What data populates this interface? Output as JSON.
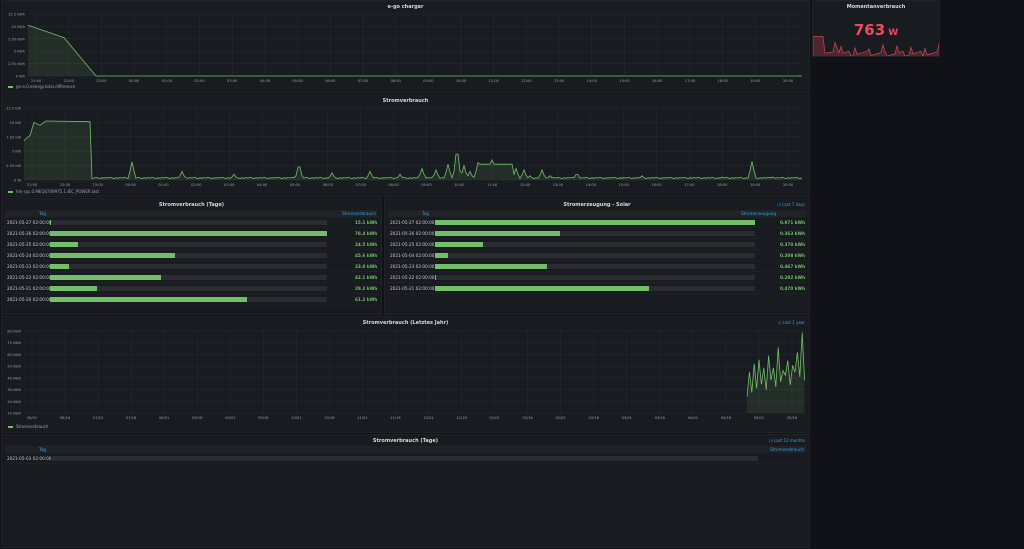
{
  "accent": "#73bf69",
  "link_color": "#33a2e5",
  "stat_color": "#f2495c",
  "x_times": [
    "21:00",
    "22:00",
    "23:00",
    "00:00",
    "01:00",
    "02:00",
    "03:00",
    "04:00",
    "05:00",
    "06:00",
    "07:00",
    "08:00",
    "09:00",
    "10:00",
    "11:00",
    "12:00",
    "13:00",
    "14:00",
    "15:00",
    "16:00",
    "17:00",
    "18:00",
    "19:00",
    "20:00"
  ],
  "charger": {
    "title": "e-go charger",
    "y_ticks": [
      "12.5 kWh",
      "10 kWh",
      "7.50 kWh",
      "5 kWh",
      "2.50 kWh",
      "0 Wh"
    ],
    "legend": "go-e.0.energy.total.difference"
  },
  "verbrauch": {
    "title": "Stromverbrauch",
    "y_ticks": [
      "12.5 kW",
      "10 kW",
      "7.50 kW",
      "5 kW",
      "2.50 kW",
      "0 W"
    ],
    "legend": "hm-rpc.0.MEQ0709975.1.IEC_POWER.last"
  },
  "moment": {
    "title": "Momentanverbrauch",
    "value": "763",
    "unit": "W"
  },
  "tage": {
    "title": "Stromverbrauch (Tage)",
    "col_tag": "Tag",
    "col_val": "Stromverbrauch",
    "rows": [
      {
        "date": "2021-05-27 02:00:00",
        "val": "15.1 kWh",
        "pct": 0.004
      },
      {
        "date": "2021-05-26 02:00:00",
        "val": "78.4 kWh",
        "pct": 1.0
      },
      {
        "date": "2021-05-25 02:00:00",
        "val": "24.5 kWh",
        "pct": 0.1
      },
      {
        "date": "2021-05-24 02:00:00",
        "val": "45.6 kWh",
        "pct": 0.45
      },
      {
        "date": "2021-05-23 02:00:00",
        "val": "23.0 kWh",
        "pct": 0.07
      },
      {
        "date": "2021-05-22 02:00:00",
        "val": "42.1 kWh",
        "pct": 0.4
      },
      {
        "date": "2021-05-21 02:00:00",
        "val": "29.2 kWh",
        "pct": 0.17
      },
      {
        "date": "2021-05-20 02:00:00",
        "val": "61.2 kWh",
        "pct": 0.71
      }
    ]
  },
  "solar": {
    "title": "Stromerzeugung - Solar",
    "time_range": "Last 7 days",
    "col_tag": "Tag",
    "col_val": "Stromerzeugung",
    "rows": [
      {
        "date": "2021-05-27 02:00:00",
        "val": "0.871 kWh",
        "pct": 1.0
      },
      {
        "date": "2021-05-26 02:00:00",
        "val": "0.363 kWh",
        "pct": 0.39
      },
      {
        "date": "2021-05-25 02:00:00",
        "val": "0.370 kWh",
        "pct": 0.15
      },
      {
        "date": "2021-05-04 02:00:00",
        "val": "0.308 kWh",
        "pct": 0.04
      },
      {
        "date": "2021-05-23 02:00:00",
        "val": "0.467 kWh",
        "pct": 0.35
      },
      {
        "date": "2021-05-22 02:00:00",
        "val": "0.282 kWh",
        "pct": 0.003
      },
      {
        "date": "2021-05-21 02:00:00",
        "val": "0.470 kWh",
        "pct": 0.67
      }
    ]
  },
  "jahr": {
    "title": "Stromverbrauch (Letztes Jahr)",
    "time_range": "Last 1 year",
    "y_ticks": [
      "80 kWh",
      "70 kWh",
      "60 kWh",
      "50 kWh",
      "40 kWh",
      "30 kWh",
      "20 kWh",
      "10 kWh"
    ],
    "x_ticks": [
      "06/01",
      "06/16",
      "07/01",
      "07/16",
      "08/01",
      "08/16",
      "09/01",
      "09/16",
      "10/01",
      "10/16",
      "11/01",
      "11/16",
      "12/01",
      "12/16",
      "01/01",
      "01/16",
      "02/01",
      "02/16",
      "03/01",
      "03/16",
      "04/01",
      "04/16",
      "05/01",
      "05/16"
    ],
    "legend": "Stromverbrauch"
  },
  "monat": {
    "title": "Stromverbrauch (Tage)",
    "time_range": "Last 12 months",
    "col_tag": "Tag",
    "col_val": "Stromverbrauch",
    "rows": [
      {
        "date": "2021-05-03 02:00:00"
      }
    ]
  }
}
